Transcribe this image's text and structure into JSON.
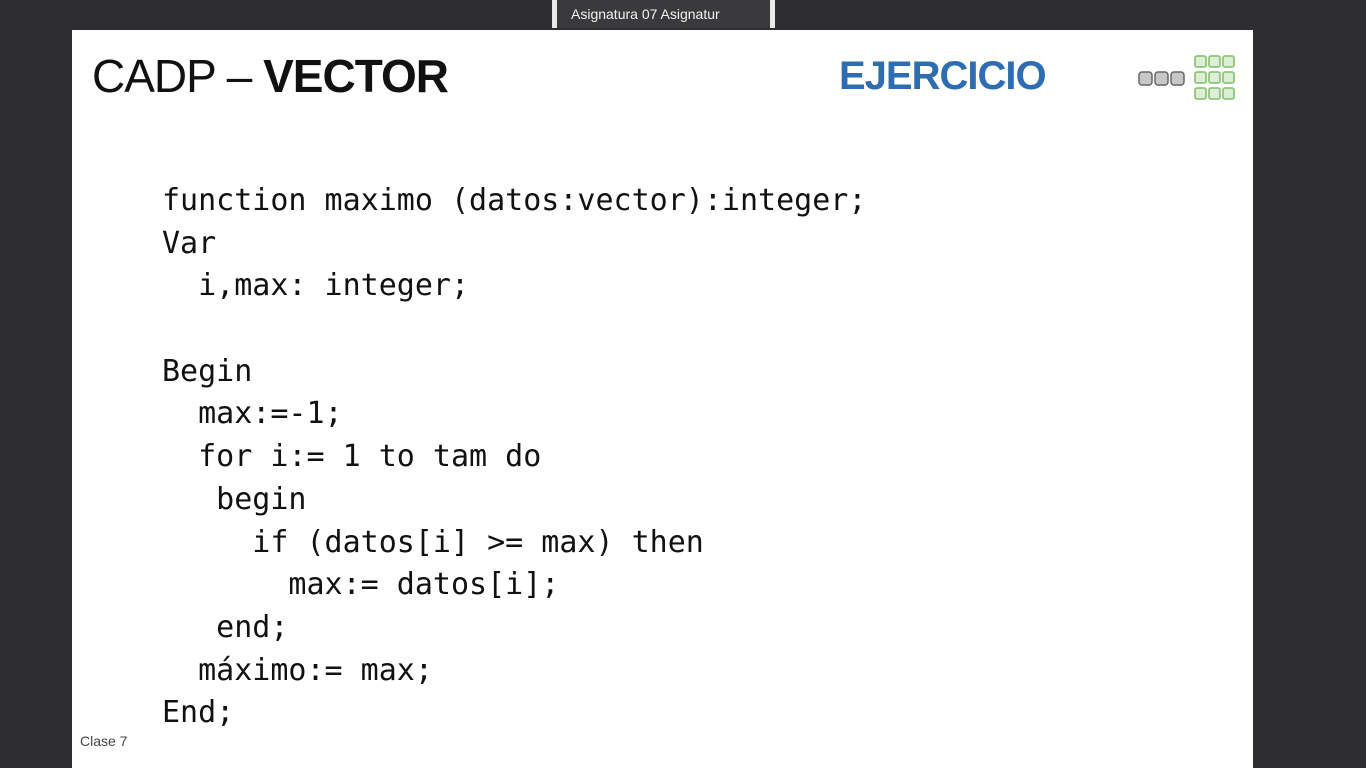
{
  "window": {
    "tab_title": "Asignatura 07 Asignatur"
  },
  "slide": {
    "title_prefix": "CADP – ",
    "title_strong": "VECTOR",
    "section_label": "EJERCICIO",
    "footer_label": "Clase 7",
    "logo_icon": "grid-logo-icon",
    "colors": {
      "section_label": "#2f6db2",
      "logo_green": "#8fc57a",
      "logo_gray": "#8b8b8b"
    },
    "code_lines": [
      "function maximo (datos:vector):integer;",
      "Var",
      "  i,max: integer;",
      "",
      "Begin",
      "  max:=-1;",
      "  for i:= 1 to tam do",
      "   begin",
      "     if (datos[i] >= max) then",
      "       max:= datos[i];",
      "   end;",
      "  máximo:= max;",
      "End;"
    ]
  }
}
